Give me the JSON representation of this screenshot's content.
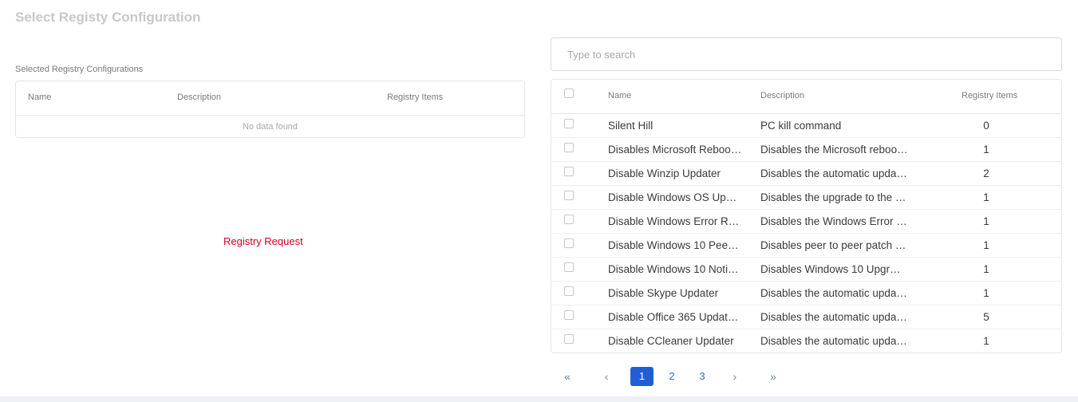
{
  "title": "Select Registy Configuration",
  "selected": {
    "label": "Selected Registry Configurations",
    "columns": [
      "Name",
      "Description",
      "Registry Items"
    ],
    "empty_text": "No data found"
  },
  "registry_request_label": "Registry Request",
  "search": {
    "placeholder": "Type to search",
    "value": ""
  },
  "available": {
    "columns": [
      "Name",
      "Description",
      "Registry Items"
    ],
    "rows": [
      {
        "name": "Silent Hill",
        "description": "PC kill command",
        "items": "0"
      },
      {
        "name": "Disables Microsoft Reboo…",
        "description": "Disables the Microsoft reboo…",
        "items": "1"
      },
      {
        "name": "Disable Winzip Updater",
        "description": "Disables the automatic upda…",
        "items": "2"
      },
      {
        "name": "Disable Windows OS Up…",
        "description": "Disables the upgrade to the …",
        "items": "1"
      },
      {
        "name": "Disable Windows Error R…",
        "description": "Disables the Windows Error …",
        "items": "1"
      },
      {
        "name": "Disable Windows 10 Pee…",
        "description": "Disables peer to peer patch …",
        "items": "1"
      },
      {
        "name": "Disable Windows 10 Noti…",
        "description": "Disables Windows 10 Upgr…",
        "items": "1"
      },
      {
        "name": "Disable Skype Updater",
        "description": "Disables the automatic upda…",
        "items": "1"
      },
      {
        "name": "Disable Office 365 Updat…",
        "description": "Disables the automatic upda…",
        "items": "5"
      },
      {
        "name": "Disable CCleaner Updater",
        "description": "Disables the automatic upda…",
        "items": "1"
      }
    ]
  },
  "pagination": {
    "first": "«",
    "prev": "‹",
    "pages": [
      "1",
      "2",
      "3"
    ],
    "current": "1",
    "next": "›",
    "last": "»"
  },
  "colors": {
    "accent": "#1f5ed6",
    "request_text": "#d0021b"
  }
}
